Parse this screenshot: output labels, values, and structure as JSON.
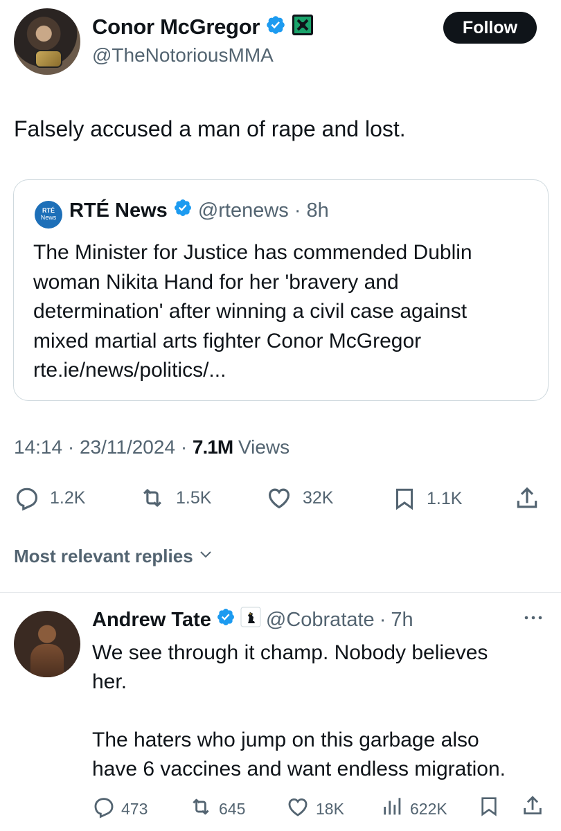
{
  "tweet": {
    "author_name": "Conor McGregor",
    "author_handle": "@TheNotoriousMMA",
    "follow_label": "Follow",
    "text": "Falsely accused a man of rape and lost.",
    "time": "14:14",
    "date": "23/11/2024",
    "views_count": "7.1M",
    "views_label": "Views",
    "stats": {
      "replies": "1.2K",
      "reposts": "1.5K",
      "likes": "32K",
      "bookmarks": "1.1K"
    }
  },
  "quote": {
    "logo_line1": "RTÉ",
    "logo_line2": "News",
    "author_name": "RTÉ News",
    "author_handle": "@rtenews",
    "age": "8h",
    "lines": [
      "The Minister for Justice has commended Dublin",
      "woman Nikita Hand for her 'bravery and",
      "determination' after winning a civil case against",
      "mixed martial arts fighter Conor McGregor",
      "rte.ie/news/politics/..."
    ]
  },
  "replies_filter": "Most relevant replies",
  "reply": {
    "author_name": "Andrew Tate",
    "author_handle": "@Cobratate",
    "age": "7h",
    "lines": [
      "We see through it champ. Nobody believes",
      "her.",
      "",
      "The haters who jump on this garbage also",
      "have 6 vaccines and want endless migration."
    ],
    "stats": {
      "replies": "473",
      "reposts": "645",
      "likes": "18K",
      "views": "622K"
    }
  },
  "colors": {
    "verified_blue": "#1d9bf0",
    "secondary_text": "#536471",
    "rte_blue": "#1d6fb8",
    "affiliate_green": "#1aa36b"
  }
}
